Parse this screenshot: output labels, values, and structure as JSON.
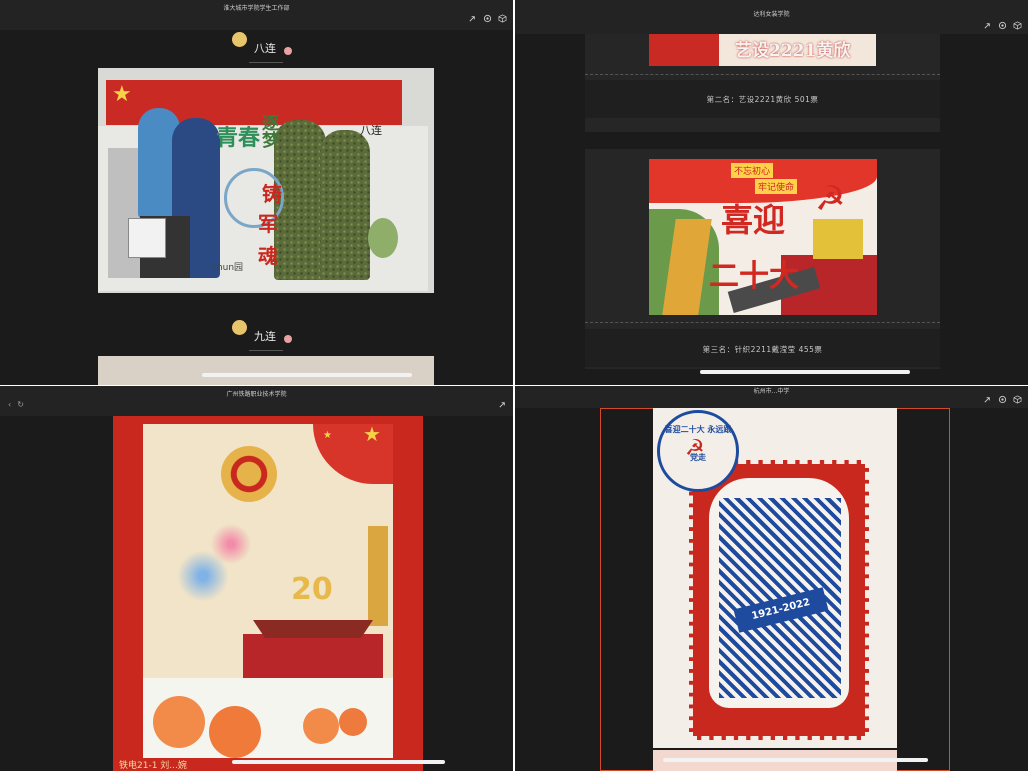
{
  "panes": {
    "top_left": {
      "title": "淮大城市学院学生工作部",
      "sections": [
        {
          "label": "八连",
          "poster_text": [
            "青春",
            "逐梦",
            "铸",
            "军",
            "魂"
          ],
          "corner_text": "八连",
          "signature": "chun园"
        },
        {
          "label": "九连"
        }
      ]
    },
    "top_right": {
      "title": "达利女装学院",
      "banner_text": "艺设2221黄欣",
      "entries": [
        {
          "caption": "第二名：艺设2221黄欣  501票"
        },
        {
          "caption": "第三名：针织2211戴滢莹  455票",
          "poster_text": [
            "喜迎",
            "二十大"
          ],
          "sign_text": [
            "不忘初心",
            "牢记使命"
          ]
        }
      ]
    },
    "bottom_left": {
      "title": "广州铁路职业技术学院",
      "poster_number": "20",
      "footer_text": "铁电21-1 刘...婉"
    },
    "bottom_right": {
      "title": "杭州市...中学",
      "stamp_text": "喜迎二十大 永远跟党走",
      "years": "1921-2022"
    }
  },
  "icons": [
    "share-icon",
    "settings-icon",
    "cube-icon",
    "back-icon",
    "refresh-icon"
  ],
  "colors": {
    "background": "#1b1b1b",
    "titlebar": "#232323",
    "accent_red": "#c8281e",
    "gold": "#e8b84a"
  }
}
